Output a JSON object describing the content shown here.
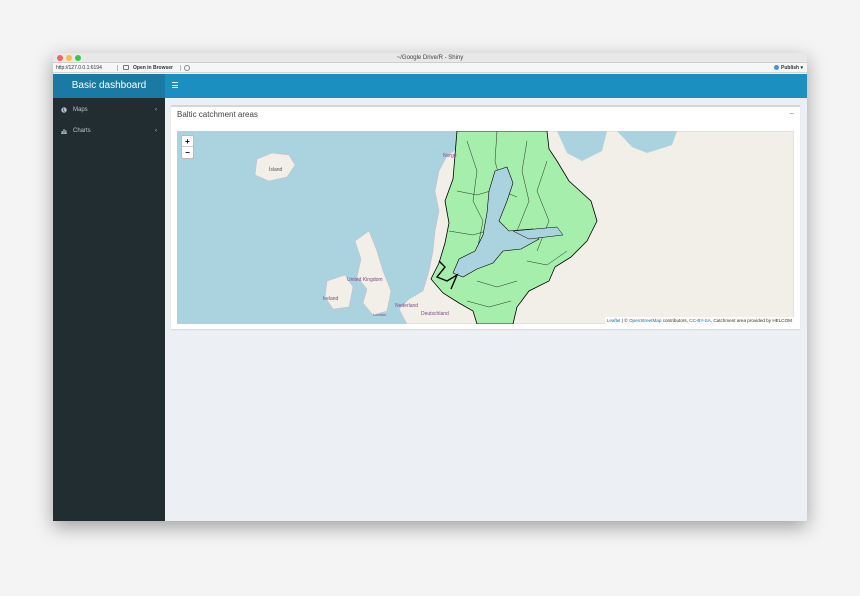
{
  "window": {
    "title": "~/Google Drive/R - Shiny"
  },
  "addressbar": {
    "url": "http://127.0.0.1:6194",
    "open_in_browser": "Open in Browser",
    "publish": "Publish"
  },
  "header": {
    "logo": "Basic dashboard"
  },
  "sidebar": {
    "items": [
      {
        "label": "Maps",
        "icon": "globe-icon"
      },
      {
        "label": "Charts",
        "icon": "bar-chart-icon"
      }
    ]
  },
  "box": {
    "title": "Baltic catchment areas",
    "collapse": "−"
  },
  "map": {
    "zoom_in": "+",
    "zoom_out": "−",
    "labels": {
      "island": "Ísland",
      "norge": "Norge",
      "united_kingdom": "United Kingdom",
      "ireland": "Ireland",
      "nederland": "Nederland",
      "deutschland": "Deutschland",
      "london": "London"
    },
    "attribution": {
      "leaflet": "Leaflet",
      "sep1": " | © ",
      "osm": "OpenStreetMap",
      "contrib": " contributors, ",
      "license": "CC-BY-SA",
      "suffix": ", Catchment area provided by HELCOM"
    },
    "colors": {
      "sea": "#aad3df",
      "land": "#f2efe9",
      "catchment": "#a6eeab"
    }
  }
}
